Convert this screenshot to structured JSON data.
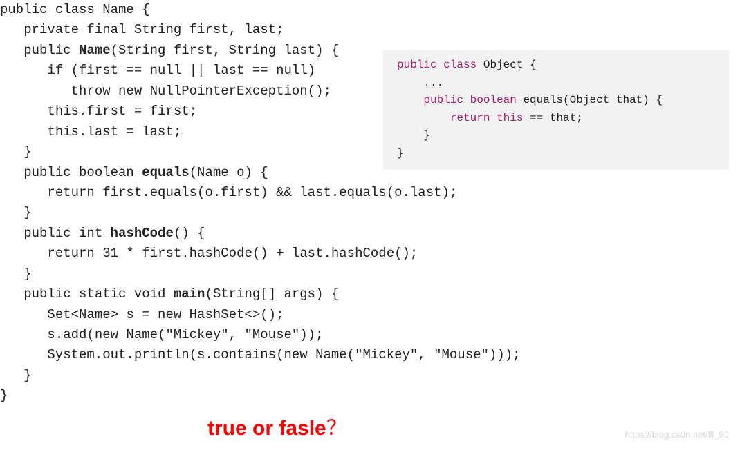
{
  "main_code": {
    "l1a": "public class Name {",
    "l2a": "   private final String first, last;",
    "l3a": "   public ",
    "l3b": "Name",
    "l3c": "(String first, String last) {",
    "l4a": "      if (first == null || last == null)",
    "l5a": "         throw new NullPointerException();",
    "l6a": "      this.first = first;",
    "l7a": "      this.last = last;",
    "l8a": "   }",
    "l9a": "   public boolean ",
    "l9b": "equals",
    "l9c": "(Name o) {",
    "l10a": "      return first.equals(o.first) && last.equals(o.last);",
    "l11a": "   }",
    "l12a": "   public int ",
    "l12b": "hashCode",
    "l12c": "() {",
    "l13a": "      return 31 * first.hashCode() + last.hashCode();",
    "l14a": "   }",
    "l15a": "   public static void ",
    "l15b": "main",
    "l15c": "(String[] args) {",
    "l16a": "      Set<Name> s = new HashSet<>();",
    "l17a": "      s.add(new Name(\"Mickey\", \"Mouse\"));",
    "l18a": "      System.out.println(s.contains(new Name(\"Mickey\", \"Mouse\")));",
    "l19a": "   }",
    "l20a": "}"
  },
  "inset_code": {
    "kw_public": "public",
    "kw_class": "class",
    "t_object": " Object {",
    "t_dots": "    ...",
    "t_ind1": "    ",
    "kw_boolean": "boolean",
    "t_equals_sig": " equals(Object that) {",
    "t_ind2": "        ",
    "kw_return": "return",
    "kw_this": "this",
    "t_eqeq": " == that;",
    "t_close1": "    }",
    "t_close2": "}"
  },
  "question_text": "true or fasle",
  "question_mark": "？",
  "watermark": "https://blog.csdn.net/lll_90"
}
